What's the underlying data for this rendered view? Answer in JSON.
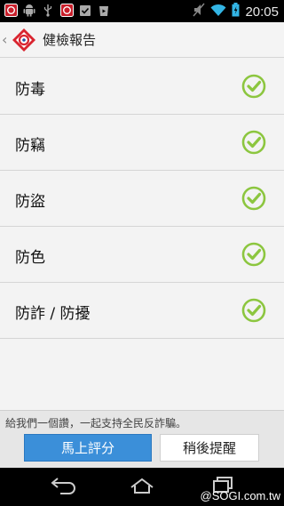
{
  "status_bar": {
    "time": "20:05",
    "icons": [
      "app-notification-icon",
      "android-icon",
      "usb-icon",
      "app-notification-icon",
      "clipboard-check-icon",
      "play-store-icon",
      "mute-icon",
      "wifi-icon",
      "battery-icon"
    ]
  },
  "action_bar": {
    "title": "健檢報告"
  },
  "list": {
    "items": [
      {
        "label": "防毒",
        "status": "ok"
      },
      {
        "label": "防竊",
        "status": "ok"
      },
      {
        "label": "防盜",
        "status": "ok"
      },
      {
        "label": "防色",
        "status": "ok"
      },
      {
        "label": "防詐 / 防擾",
        "status": "ok"
      }
    ]
  },
  "prompt": {
    "text": "給我們一個讚，一起支持全民反詐騙。",
    "rate_now": "馬上評分",
    "remind_later": "稍後提醒"
  },
  "watermark": "@SOGI.com.tw",
  "colors": {
    "accent_blue": "#3b8fd9",
    "check_green": "#8cc63f"
  }
}
